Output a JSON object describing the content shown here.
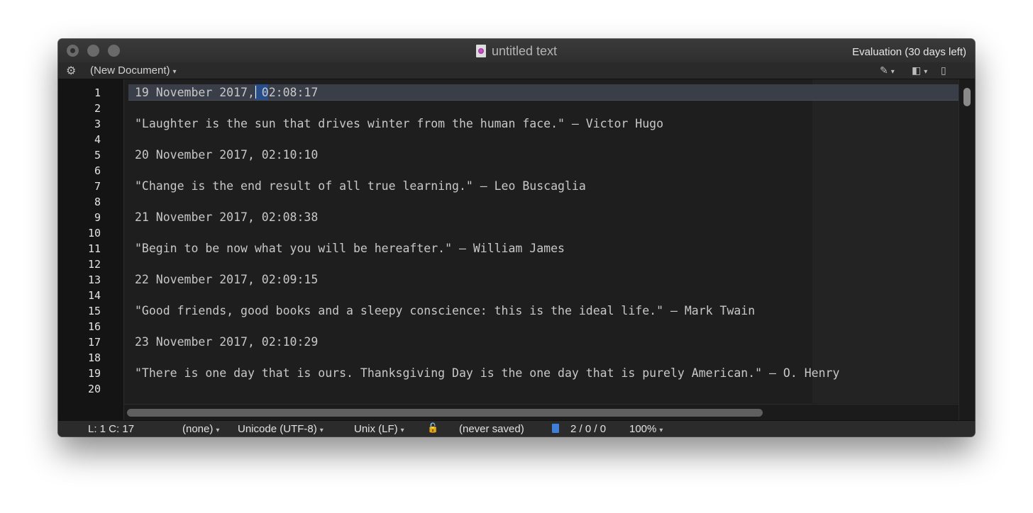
{
  "window": {
    "title": "untitled text",
    "evaluation": "Evaluation (30 days left)"
  },
  "toolbar": {
    "document_menu": "(New Document)"
  },
  "editor": {
    "line_numbers": [
      "1",
      "2",
      "3",
      "4",
      "5",
      "6",
      "7",
      "8",
      "9",
      "10",
      "11",
      "12",
      "13",
      "14",
      "15",
      "16",
      "17",
      "18",
      "19",
      "20"
    ],
    "lines": [
      "19 November 2017, 02:08:17",
      "",
      "\"Laughter is the sun that drives winter from the human face.\" — Victor Hugo",
      "",
      "20 November 2017, 02:10:10",
      "",
      "\"Change is the end result of all true learning.\" — Leo Buscaglia",
      "",
      "21 November 2017, 02:08:38",
      "",
      "\"Begin to be now what you will be hereafter.\" — William James",
      "",
      "22 November 2017, 02:09:15",
      "",
      "\"Good friends, good books and a sleepy conscience: this is the ideal life.\" — Mark Twain",
      "",
      "23 November 2017, 02:10:29",
      "",
      "\"There is one day that is ours. Thanksgiving Day is the one day that is purely American.\" — O. Henry",
      ""
    ]
  },
  "statusbar": {
    "cursor_position": "L: 1 C: 17",
    "language": "(none)",
    "encoding": "Unicode (UTF-8)",
    "line_endings": "Unix (LF)",
    "save_state": "(never saved)",
    "counts": "2 / 0 / 0",
    "zoom": "100%"
  },
  "icons": {
    "gear": "gear-icon",
    "pen": "pen-icon",
    "window": "window-icon",
    "document": "document-icon",
    "lock": "lock-icon"
  },
  "colors": {
    "background": "#1e1e1e",
    "current_line": "#3a3e48",
    "selection": "#274d8a",
    "text": "#c8c8c8"
  }
}
